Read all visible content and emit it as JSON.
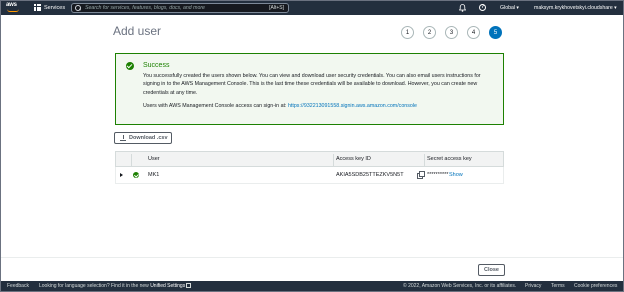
{
  "topnav": {
    "logo_text": "aws",
    "services_label": "Services",
    "search_placeholder": "Search for services, features, blogs, docs, and more",
    "search_shortcut": "[Alt+S]",
    "region_label": "Global ▾",
    "user_label": "maksym.krykhovetskyi.cloudshare ▾"
  },
  "header": {
    "title": "Add user",
    "steps": [
      "1",
      "2",
      "3",
      "4",
      "5"
    ],
    "active_step": "5"
  },
  "success": {
    "title": "Success",
    "body": "You successfully created the users shown below. You can view and download user security credentials. You can also email users instructions for signing in to the AWS Management Console. This is the last time these credentials will be available to download. However, you can create new credentials at any time.",
    "console_text": "Users with AWS Management Console access can sign-in at:",
    "console_url": "https://932213091558.signin.aws.amazon.com/console"
  },
  "download_button": "Download .csv",
  "table": {
    "columns": [
      "User",
      "Access key ID",
      "Secret access key"
    ],
    "rows": [
      {
        "user": "MK1",
        "access_key_id": "AKIA5SDB25TTEZKV5N5T",
        "secret_masked": "**********",
        "secret_action": "Show"
      }
    ]
  },
  "close_button": "Close",
  "footer": {
    "feedback": "Feedback",
    "language_prompt": "Looking for language selection? Find it in the new",
    "unified_settings": "Unified Settings",
    "copyright": "© 2022, Amazon Web Services, Inc. or its affiliates.",
    "privacy": "Privacy",
    "terms": "Terms",
    "cookie": "Cookie preferences"
  },
  "colors": {
    "nav_bg": "#232f3e",
    "success_green": "#1d8102",
    "success_bg": "#f2f8f0",
    "link_blue": "#0073bb",
    "brand_orange": "#ff9900"
  }
}
